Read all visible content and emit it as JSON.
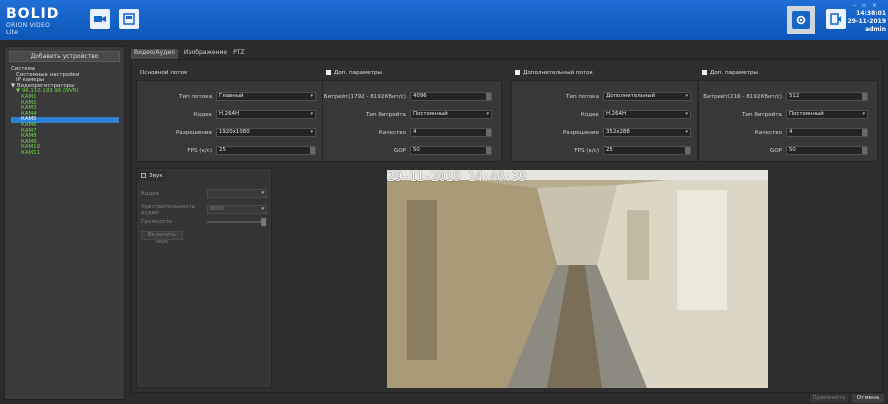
{
  "app": {
    "logo_main": "BOLID",
    "logo_sub": "ORION VIDEO Lite",
    "time": "14:38:01",
    "date": "29-11-2019",
    "user": "admin"
  },
  "sidebar": {
    "add_device": "Добавить устройство",
    "tree": [
      {
        "label": "Система",
        "level": 0,
        "green": false,
        "selected": false
      },
      {
        "label": "Системные настройки",
        "level": 1,
        "green": false,
        "selected": false
      },
      {
        "label": "IP камеры",
        "level": 1,
        "green": false,
        "selected": false
      },
      {
        "label": "▼ Видеорегистраторы",
        "level": 0,
        "green": false,
        "selected": false
      },
      {
        "label": "▼ 96.110.193.96 (NVR)",
        "level": 1,
        "green": true,
        "selected": false
      },
      {
        "label": "КАМ1",
        "level": 2,
        "green": true,
        "selected": false
      },
      {
        "label": "КАМ2",
        "level": 2,
        "green": true,
        "selected": false
      },
      {
        "label": "КАМ3",
        "level": 2,
        "green": true,
        "selected": false
      },
      {
        "label": "КАМ4",
        "level": 2,
        "green": true,
        "selected": false
      },
      {
        "label": "КАМ5",
        "level": 2,
        "green": false,
        "selected": true
      },
      {
        "label": "КАМ6",
        "level": 2,
        "green": true,
        "selected": false
      },
      {
        "label": "КАМ7",
        "level": 2,
        "green": true,
        "selected": false
      },
      {
        "label": "КАМ8",
        "level": 2,
        "green": true,
        "selected": false
      },
      {
        "label": "КАМ9",
        "level": 2,
        "green": true,
        "selected": false
      },
      {
        "label": "КАМ10",
        "level": 2,
        "green": true,
        "selected": false
      },
      {
        "label": "КАМ11",
        "level": 2,
        "green": true,
        "selected": false
      }
    ]
  },
  "tabs": [
    "Видео/Аудио",
    "Изображение",
    "PTZ"
  ],
  "main_stream": {
    "header": "Основной поток",
    "stream_type_label": "Тип потока",
    "stream_type": "Главный",
    "codec_label": "Кодек",
    "codec": "H.264H",
    "resolution_label": "Разрешение",
    "resolution": "1920x1080",
    "fps_label": "FPS (к/с)",
    "fps": "25"
  },
  "main_extra": {
    "header": "Доп. параметры",
    "bitrate_label": "Битрейт(1792 - 8192Кбит/с)",
    "bitrate": "4096",
    "bitrate_type_label": "Тип битрейта",
    "bitrate_type": "Постоянный",
    "quality_label": "Качество",
    "quality": "4",
    "gop_label": "GOP",
    "gop": "50"
  },
  "sub_stream": {
    "header": "Дополнительный поток",
    "stream_type_label": "Тип потока",
    "stream_type": "Дополнительный",
    "codec_label": "Кодек",
    "codec": "H.264H",
    "resolution_label": "Разрешение",
    "resolution": "352x288",
    "fps_label": "FPS (к/с)",
    "fps": "25"
  },
  "sub_extra": {
    "header": "Доп. параметры",
    "bitrate_label": "Битрейт(216 - 8192Кбит/с)",
    "bitrate": "512",
    "bitrate_type_label": "Тип битрейта",
    "bitrate_type": "Постоянный",
    "quality_label": "Качество",
    "quality": "4",
    "gop_label": "GOP",
    "gop": "50"
  },
  "audio": {
    "header": "Звук",
    "codec_label": "Кодек",
    "sensitivity_label": "Чувствительность аудио",
    "sensitivity": "8000",
    "volume_label": "Громкость",
    "enable_btn": "Включить звук"
  },
  "video": {
    "timestamp": "29-11-2019 14:46:39"
  },
  "footer": {
    "apply": "Применить",
    "cancel": "Отмена"
  }
}
